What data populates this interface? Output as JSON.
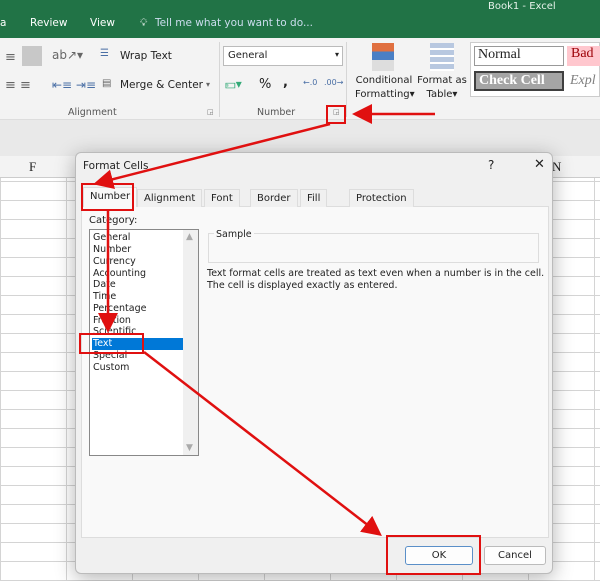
{
  "window": {
    "title": "Book1 - Excel"
  },
  "tabs": [
    {
      "label": "a"
    },
    {
      "label": "Review"
    },
    {
      "label": "View"
    }
  ],
  "tell_me": "Tell me what you want to do...",
  "ribbon": {
    "wrap_text": "Wrap Text",
    "merge_center": "Merge & Center",
    "alignment_label": "Alignment",
    "number_format": "General",
    "percent": "%",
    "comma": ",",
    "number_label": "Number",
    "conditional_formatting": [
      "Conditional",
      "Formatting"
    ],
    "format_as_table": [
      "Format as",
      "Table"
    ],
    "styles": {
      "normal": "Normal",
      "bad": "Bad",
      "check_cell": "Check Cell",
      "explanatory": "Expl"
    }
  },
  "columns": {
    "left": "F",
    "right": "N"
  },
  "dialog": {
    "title": "Format Cells",
    "help": "?",
    "close": "✕",
    "tabs": [
      "Number",
      "Alignment",
      "Font",
      "Border",
      "Fill",
      "Protection"
    ],
    "category_label": "Category:",
    "categories": [
      "General",
      "Number",
      "Currency",
      "Accounting",
      "Date",
      "Time",
      "Percentage",
      "Fraction",
      "Scientific",
      "Text",
      "Special",
      "Custom"
    ],
    "selected_category": "Text",
    "sample_label": "Sample",
    "description": [
      "Text format cells are treated as text even when a number is in the cell.",
      "The cell is displayed exactly as entered."
    ],
    "ok": "OK",
    "cancel": "Cancel"
  },
  "colors": {
    "excel_green": "#217346",
    "selection": "#0078d7",
    "annotation": "#e01010"
  }
}
